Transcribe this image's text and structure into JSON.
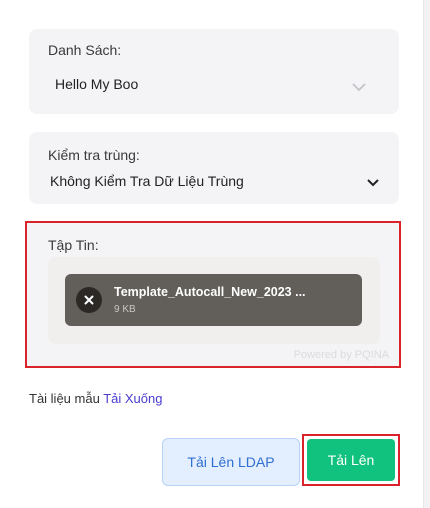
{
  "list_field": {
    "label": "Danh Sách:",
    "value": "Hello My Boo",
    "chevron_icon": "chevron-down-icon"
  },
  "duplicate_field": {
    "label": "Kiểm tra trùng:",
    "value": "Không Kiểm Tra Dữ Liệu Trùng",
    "chevron_icon": "chevron-down-icon"
  },
  "file_field": {
    "label": "Tập Tin:",
    "file_name": "Template_Autocall_New_2023 ...",
    "file_size": "9 KB",
    "remove_icon": "close-icon",
    "powered_by": "Powered by PQINA"
  },
  "sample": {
    "text": "Tài liệu mẫu",
    "link": "Tải Xuống"
  },
  "buttons": {
    "ldap_upload": "Tải Lên LDAP",
    "upload": "Tải Lên"
  },
  "colors": {
    "accent_green": "#11c27f",
    "highlight_red": "#d9222a",
    "link_purple": "#4a3ccf",
    "ldap_blue": "#2f6fd1"
  }
}
